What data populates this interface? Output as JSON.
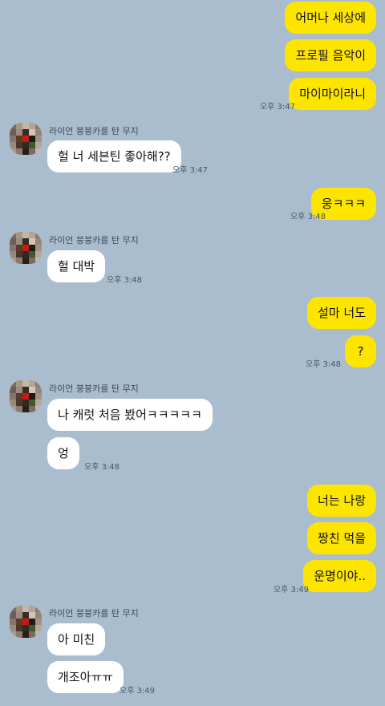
{
  "contact": {
    "name": "라이언 붕붕카를 탄 무지"
  },
  "messages": [
    {
      "text": "어머나 세상에",
      "from": "me"
    },
    {
      "text": "프로필 음악이",
      "from": "me"
    },
    {
      "text": "마이마이라니",
      "from": "me",
      "time": "오후 3:47"
    },
    {
      "text": "헐 너 세븐틴 좋아해??",
      "from": "them",
      "time": "오후 3:47"
    },
    {
      "text": "웅ㅋㅋㅋ",
      "from": "me",
      "time": "오후 3:48"
    },
    {
      "text": "헐 대박",
      "from": "them",
      "time": "오후 3:48"
    },
    {
      "text": "설마 너도",
      "from": "me"
    },
    {
      "text": "?",
      "from": "me",
      "time": "오후 3:48"
    },
    {
      "text": "나 캐럿 처음 봤어ㅋㅋㅋㅋㅋ",
      "from": "them"
    },
    {
      "text": "엉",
      "from": "them",
      "time": "오후 3:48"
    },
    {
      "text": "너는 나랑",
      "from": "me"
    },
    {
      "text": "짱친 먹을",
      "from": "me"
    },
    {
      "text": "운명이야..",
      "from": "me",
      "time": "오후 3:49"
    },
    {
      "text": "아 미친",
      "from": "them"
    },
    {
      "text": "개조아ㅠㅠ",
      "from": "them",
      "time": "오후 3:49"
    }
  ],
  "colors": {
    "background": "#a9bdce",
    "my_bubble": "#fee500",
    "their_bubble": "#ffffff"
  }
}
